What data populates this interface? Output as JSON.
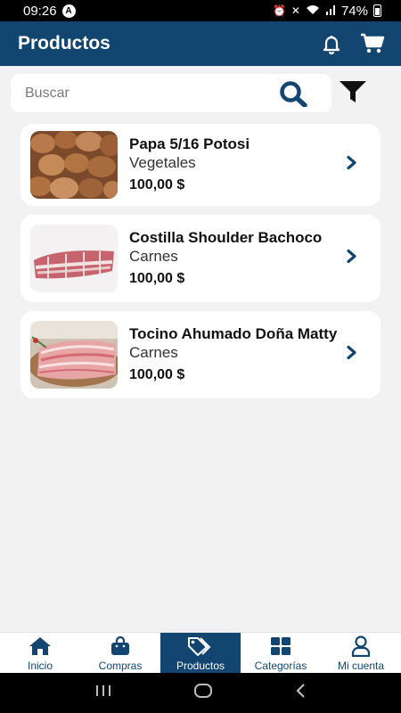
{
  "status_bar": {
    "time": "09:26",
    "battery": "74%"
  },
  "header": {
    "title": "Productos",
    "icons": [
      "bell-icon",
      "cart-icon"
    ]
  },
  "search": {
    "placeholder": "Buscar",
    "value": ""
  },
  "products": [
    {
      "name": "Papa 5/16 Potosi",
      "category": "Vegetales",
      "price": "100,00 $",
      "image": "potatoes"
    },
    {
      "name": "Costilla Shoulder Bachoco",
      "category": "Carnes",
      "price": "100,00 $",
      "image": "ribs"
    },
    {
      "name": "Tocino Ahumado Doña Matty",
      "category": "Carnes",
      "price": "100,00 $",
      "image": "bacon"
    }
  ],
  "bottom_nav": {
    "items": [
      {
        "label": "Inicio",
        "icon": "home-icon"
      },
      {
        "label": "Compras",
        "icon": "shopping-bag-icon"
      },
      {
        "label": "Productos",
        "icon": "tag-icon",
        "active": true
      },
      {
        "label": "Categorías",
        "icon": "grid-icon"
      },
      {
        "label": "Mi cuenta",
        "icon": "user-icon"
      }
    ]
  },
  "colors": {
    "primary": "#12456f",
    "background": "#f2f2f2"
  }
}
